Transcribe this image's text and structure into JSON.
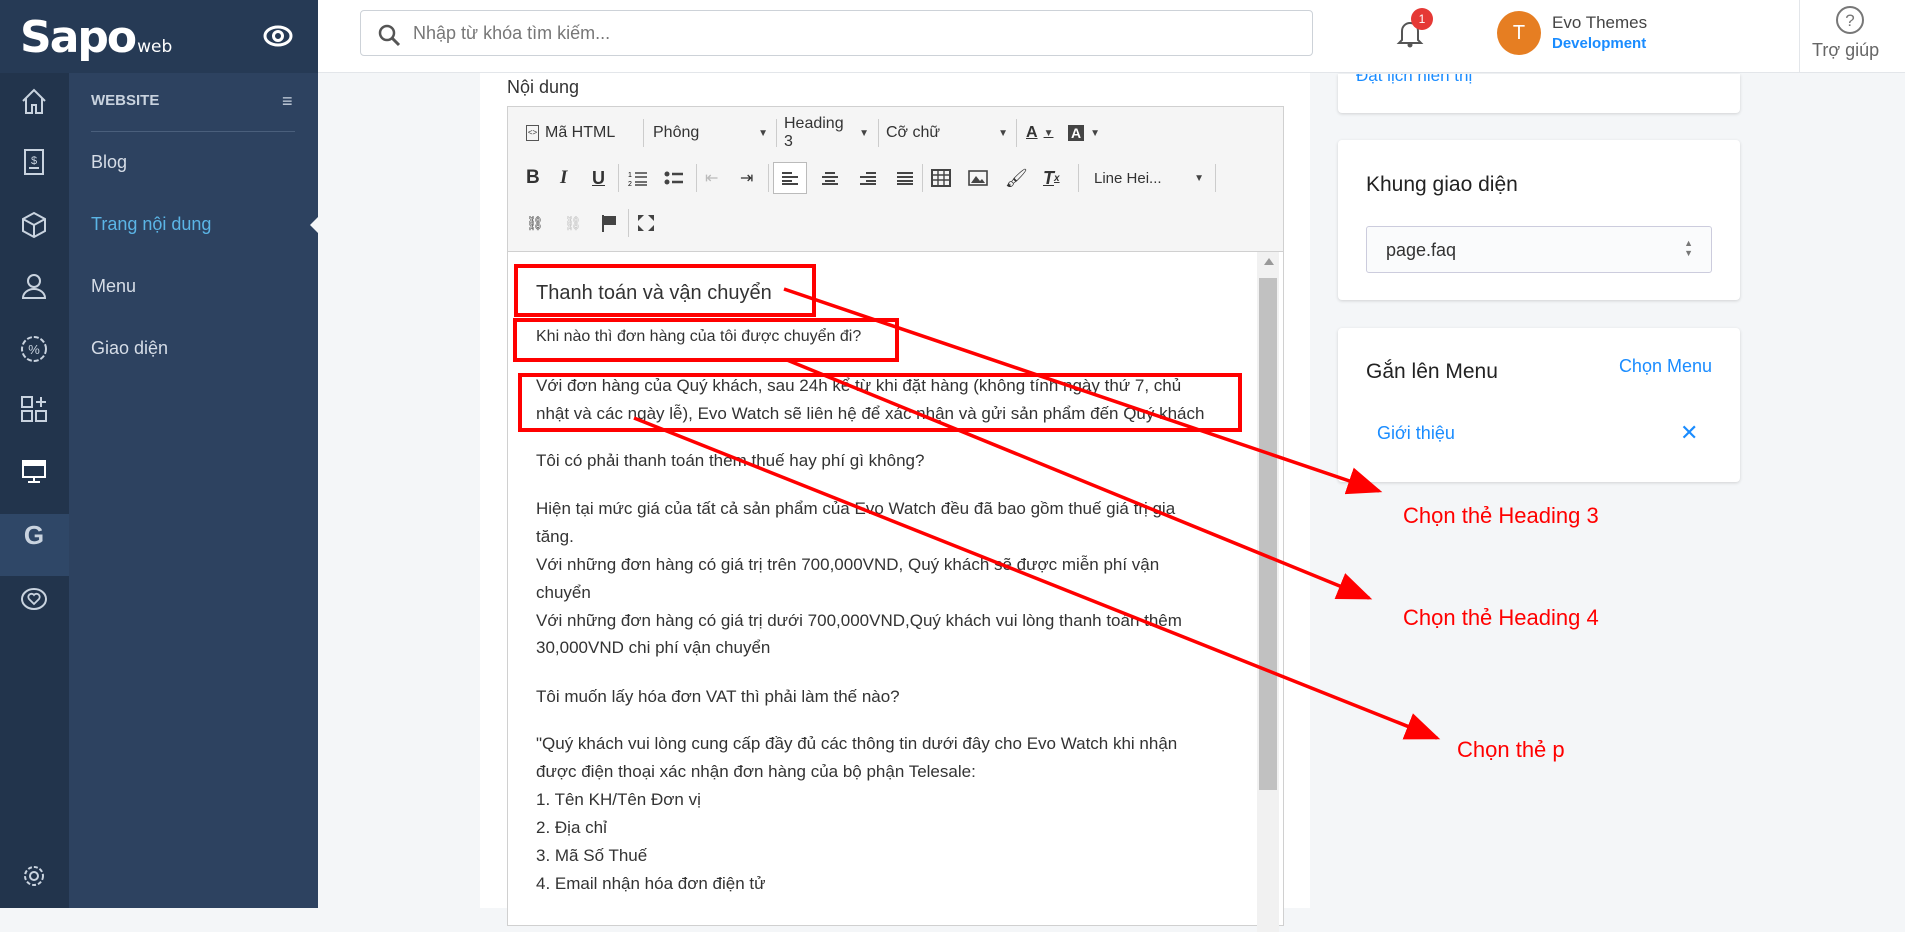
{
  "brand": {
    "logo": "Sapo",
    "logo_suffix": "web"
  },
  "header": {
    "search_placeholder": "Nhập từ khóa tìm kiếm...",
    "notification_count": "1",
    "user_initial": "T",
    "user_name": "Evo Themes",
    "user_role": "Development",
    "help_label": "Trợ giúp"
  },
  "sidebar": {
    "section_title": "WEBSITE",
    "items": [
      {
        "label": "Blog"
      },
      {
        "label": "Trang nội dung"
      },
      {
        "label": "Menu"
      },
      {
        "label": "Giao diện"
      }
    ]
  },
  "editor": {
    "label": "Nội dung",
    "toolbar": {
      "html": "Mã HTML",
      "font": "Phông",
      "format": "Heading 3",
      "size": "Cỡ chữ",
      "line_height": "Line Hei..."
    },
    "lines": [
      "Khi nào thì đơn hàng của tôi được chuyển đi?",
      "Với đơn hàng của Quý khách, sau 24h kể từ khi đặt hàng (không tính ngày thứ 7, chủ",
      "nhật và các ngày lễ), Evo Watch sẽ liên hệ để xác nhận và gửi sản phẩm đến Quý khách",
      "Tôi có phải thanh toán thêm thuế hay phí gì không?",
      "Hiện tại mức giá của tất cả sản phẩm của Evo Watch đều đã bao gồm thuế giá trị gia",
      "tăng.",
      "Với những đơn hàng có giá trị trên 700,000VND, Quý khách sẽ được miễn phí vận",
      "chuyển",
      "Với những đơn hàng có giá trị dưới 700,000VND,Quý khách vui lòng thanh toán thêm",
      "30,000VND chi phí vận chuyển",
      "Tôi muốn lấy hóa đơn VAT thì phải làm thế nào?",
      "\"Quý khách vui lòng cung cấp đầy đủ các thông tin dưới đây cho Evo Watch khi nhận",
      "được điện thoại xác nhận đơn hàng của bộ phận Telesale:",
      "1. Tên KH/Tên Đơn vị",
      "2. Địa chỉ",
      "3. Mã Số Thuế",
      "4. Email nhận hóa đơn điện tử"
    ],
    "heading": "Thanh toán và vận chuyển"
  },
  "right": {
    "schedule_link": "Đặt lịch hiển thị",
    "template_title": "Khung giao diện",
    "template_value": "page.faq",
    "menu_title": "Gắn lên Menu",
    "menu_choose": "Chọn Menu",
    "menu_item": "Giới thiệu"
  },
  "annotations": {
    "h3": "Chọn thẻ Heading 3",
    "h4": "Chọn thẻ Heading 4",
    "p": "Chọn thẻ p"
  },
  "colors": {
    "accent": "#1a8cff",
    "sidebar_active": "#5bb5e6",
    "annotation": "#ff0000",
    "avatar": "#e67e22"
  }
}
